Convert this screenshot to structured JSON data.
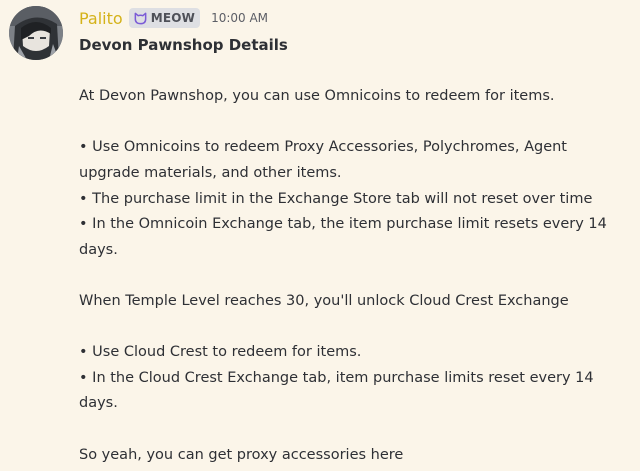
{
  "message": {
    "author": "Palito",
    "author_color": "#d4b21a",
    "tag": {
      "icon": "cat-face-icon",
      "label": "MEOW"
    },
    "timestamp": "10:00 AM",
    "title": "Devon Pawnshop Details",
    "paragraphs": [
      "At Devon Pawnshop, you can use Omnicoins to redeem for items.",
      "• Use Omnicoins to redeem Proxy Accessories, Polychromes, Agent upgrade materials, and other items.",
      "• The purchase limit in the Exchange Store tab will not reset over time",
      " • In the Omnicoin Exchange tab, the item purchase limit resets every 14 days.",
      "When Temple Level reaches 30, you'll unlock Cloud Crest Exchange",
      " • Use Cloud Crest to redeem for items.",
      " • In the Cloud Crest Exchange tab, item purchase limits reset every 14 days.",
      "So yeah, you can get proxy accessories here"
    ]
  },
  "colors": {
    "background": "#fbf5e9",
    "text": "#2e3035",
    "tag_background": "#dedfe3",
    "tag_icon": "#7b5bd6"
  }
}
